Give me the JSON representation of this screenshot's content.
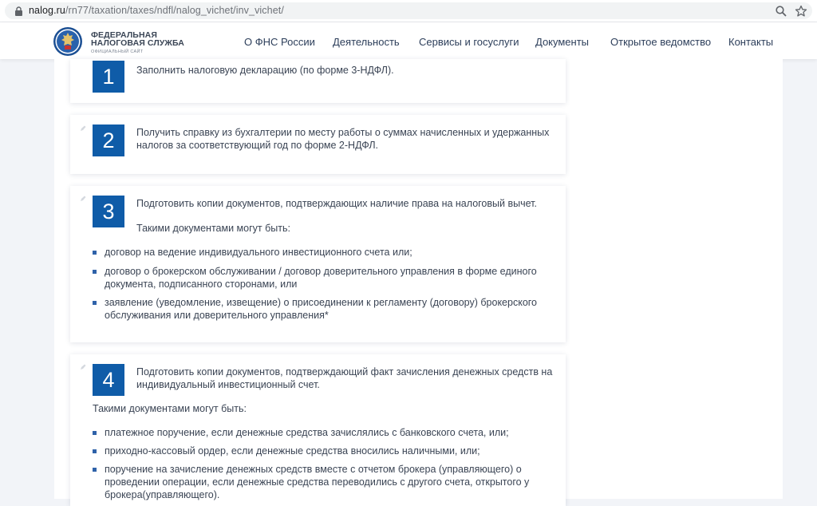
{
  "browser": {
    "url_host": "nalog.ru",
    "url_path": "/rn77/taxation/taxes/ndfl/nalog_vichet/inv_vichet/",
    "icons": [
      "lock-icon",
      "zoom-icon",
      "star-icon"
    ]
  },
  "header": {
    "brand_line1": "ФЕДЕРАЛЬНАЯ",
    "brand_line2": "НАЛОГОВАЯ СЛУЖБА",
    "brand_line3": "ОФИЦИАЛЬНЫЙ САЙТ",
    "nav": [
      "О ФНС России",
      "Деятельность",
      "Сервисы и госуслуги",
      "Документы",
      "Открытое ведомство",
      "Контакты"
    ]
  },
  "steps": [
    {
      "number": "1",
      "text": "Заполнить налоговую декларацию (по форме 3-НДФЛ)."
    },
    {
      "number": "2",
      "text_line1": "Получить справку из бухгалтерии по месту работы о суммах начисленных и удержанных",
      "text_line2": "налогов за соответствующий год по форме 2-НДФЛ."
    },
    {
      "number": "3",
      "text": "Подготовить копии документов, подтверждающих наличие права на налоговый вычет.",
      "subtitle": "Такими документами могут быть:",
      "items": [
        {
          "line1": "договор на ведение индивидуального инвестиционного счета или;"
        },
        {
          "line1": "договор о брокерском обслуживании / договор доверительного управления в форме единого",
          "line2": "документа, подписанного сторонами, или"
        },
        {
          "line1": "заявление (уведомление, извещение) о присоединении к регламенту (договору) брокерского",
          "line2": "обслуживания или доверительного управления*"
        }
      ]
    },
    {
      "number": "4",
      "text_line1": "Подготовить копии документов, подтверждающий факт зачисления денежных средств на",
      "text_line2": "индивидуальный инвестиционный счет.",
      "subtitle": "Такими документами могут быть:",
      "items": [
        {
          "line1": "платежное поручение, если денежные средства зачислялись с банковского счета, или;"
        },
        {
          "line1": "приходно-кассовый ордер, если денежные средства вносились наличными, или;"
        },
        {
          "line1": "поручение на зачисление денежных средств вместе с отчетом брокера (управляющего) о",
          "line2": "проведении операции, если денежные средства переводились с другого счета, открытого у",
          "line3": "брокера(управляющего)."
        }
      ]
    }
  ],
  "colors": {
    "accent": "#0f5ca8",
    "bullet": "#2f62a9",
    "nav_text": "#2c3e5a"
  }
}
